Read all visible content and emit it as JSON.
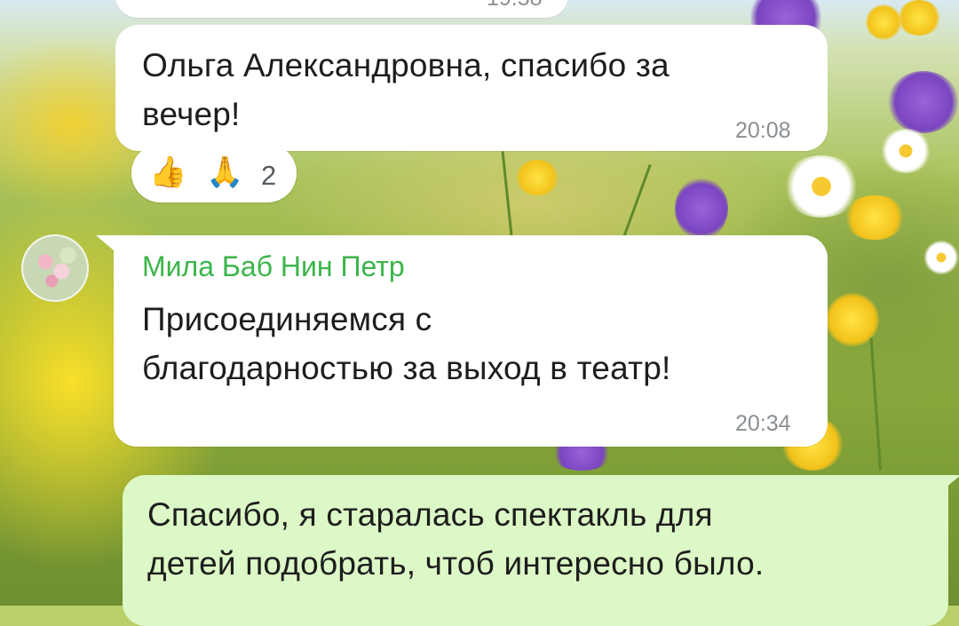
{
  "chat": {
    "messages": [
      {
        "id": "partial-top",
        "direction": "incoming",
        "time": "19:58",
        "partial": true
      },
      {
        "id": "olga-thanks",
        "direction": "incoming",
        "text_line1": "Ольга Александровна, спасибо за",
        "text_line2": "вечер!",
        "time": "20:08",
        "reactions": {
          "emoji1": "👍",
          "emoji2": "🙏",
          "count": "2"
        }
      },
      {
        "id": "mila-join",
        "direction": "incoming",
        "sender": "Мила Баб Нин Петр",
        "sender_color": "#3bb54a",
        "text_line1": "Присоединяемся с",
        "text_line2": "благодарностью за выход в театр!",
        "time": "20:34"
      },
      {
        "id": "my-reply",
        "direction": "outgoing",
        "text_line1": "Спасибо, я старалась спектакль для",
        "text_line2": "детей подобрать, чтоб интересно было."
      }
    ]
  },
  "colors": {
    "incoming_bubble": "#ffffff",
    "outgoing_bubble": "#dcf8c6",
    "timestamp": "#8a8f93"
  },
  "icons": [
    "thumbs-up-emoji",
    "folded-hands-emoji",
    "avatar-image"
  ]
}
